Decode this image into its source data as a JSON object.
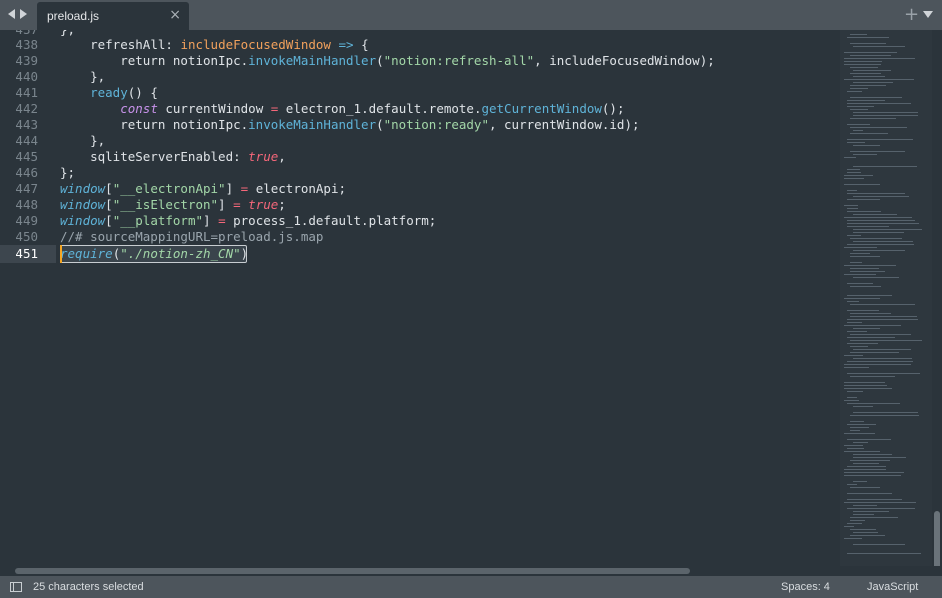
{
  "tab": {
    "title": "preload.js",
    "close_glyph": "×"
  },
  "toolbar": {
    "new_tab_glyph": "+"
  },
  "editor": {
    "top_partial": "},",
    "lines": [
      {
        "n": "438",
        "text": "    refreshAll: includeFocusedWindow => {"
      },
      {
        "n": "439",
        "text": "        return notionIpc.invokeMainHandler(\"notion:refresh-all\", includeFocusedWindow);"
      },
      {
        "n": "440",
        "text": "    },"
      },
      {
        "n": "441",
        "text": "    ready() {"
      },
      {
        "n": "442",
        "text": "        const currentWindow = electron_1.default.remote.getCurrentWindow();"
      },
      {
        "n": "443",
        "text": "        return notionIpc.invokeMainHandler(\"notion:ready\", currentWindow.id);"
      },
      {
        "n": "444",
        "text": "    },"
      },
      {
        "n": "445",
        "text": "    sqliteServerEnabled: true,"
      },
      {
        "n": "446",
        "text": "};"
      },
      {
        "n": "447",
        "text": "window[\"__electronApi\"] = electronApi;"
      },
      {
        "n": "448",
        "text": "window[\"__isElectron\"] = true;"
      },
      {
        "n": "449",
        "text": "window[\"__platform\"] = process_1.default.platform;"
      },
      {
        "n": "450",
        "text": "//# sourceMappingURL=preload.js.map"
      },
      {
        "n": "451",
        "text": "require(\"./notion-zh_CN\")"
      }
    ],
    "active_line": "451"
  },
  "status": {
    "selection_text": "25 characters selected",
    "indent": "Spaces: 4",
    "syntax": "JavaScript"
  },
  "colors": {
    "background": "#2b343b",
    "tabbar": "#4d555c",
    "caret": "#f5a623",
    "keyword_orange": "#f2a15c",
    "function_blue": "#5fb3d8",
    "string_green": "#a3d7a8",
    "boolean_red": "#f5677a"
  }
}
